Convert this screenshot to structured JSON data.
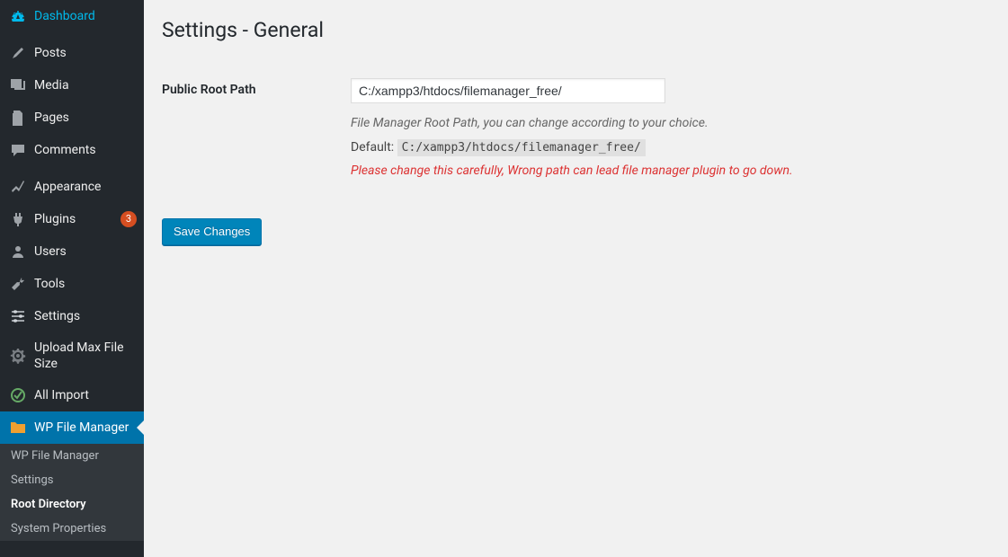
{
  "sidebar": {
    "items": [
      {
        "label": "Dashboard",
        "icon": "dashboard"
      },
      {
        "label": "Posts",
        "icon": "pin"
      },
      {
        "label": "Media",
        "icon": "media"
      },
      {
        "label": "Pages",
        "icon": "pages"
      },
      {
        "label": "Comments",
        "icon": "comments"
      },
      {
        "label": "Appearance",
        "icon": "appearance"
      },
      {
        "label": "Plugins",
        "icon": "plugins",
        "badge": "3"
      },
      {
        "label": "Users",
        "icon": "users"
      },
      {
        "label": "Tools",
        "icon": "tools"
      },
      {
        "label": "Settings",
        "icon": "settings"
      },
      {
        "label": "Upload Max File Size",
        "icon": "gear"
      },
      {
        "label": "All Import",
        "icon": "import"
      },
      {
        "label": "WP File Manager",
        "icon": "folder",
        "active": true
      }
    ],
    "submenu": [
      {
        "label": "WP File Manager"
      },
      {
        "label": "Settings"
      },
      {
        "label": "Root Directory",
        "current": true
      },
      {
        "label": "System Properties"
      }
    ]
  },
  "page": {
    "title": "Settings - General",
    "field_label": "Public Root Path",
    "input_value": "C:/xampp3/htdocs/filemanager_free/",
    "description": "File Manager Root Path, you can change according to your choice.",
    "default_prefix": "Default: ",
    "default_value": "C:/xampp3/htdocs/filemanager_free/",
    "warning": "Please change this carefully, Wrong path can lead file manager plugin to go down.",
    "save_button": "Save Changes"
  }
}
